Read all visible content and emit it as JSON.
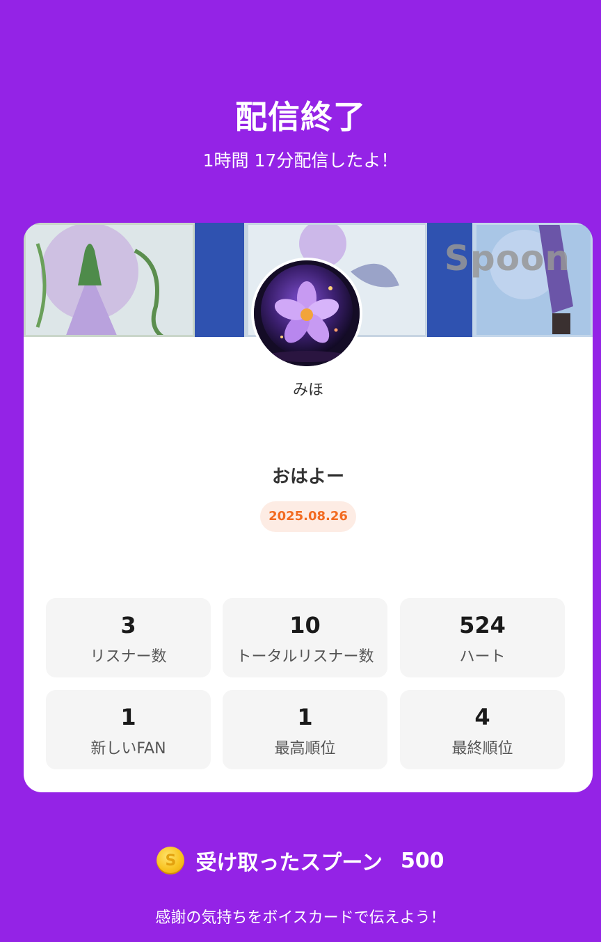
{
  "header": {
    "title": "配信終了",
    "subtitle": "1時間 17分配信したよ！"
  },
  "card": {
    "banner_watermark": "Spoon",
    "username": "みほ",
    "live_title": "おはよー",
    "date": "2025.08.26",
    "stats": [
      {
        "value": "3",
        "label": "リスナー数"
      },
      {
        "value": "10",
        "label": "トータルリスナー数"
      },
      {
        "value": "524",
        "label": "ハート"
      },
      {
        "value": "1",
        "label": "新しいFAN"
      },
      {
        "value": "1",
        "label": "最高順位"
      },
      {
        "value": "4",
        "label": "最終順位"
      }
    ]
  },
  "spoons": {
    "icon": "coin-icon",
    "icon_glyph": "S",
    "label": "受け取ったスプーン",
    "count": "500"
  },
  "footer": {
    "message": "感謝の気持ちをボイスカードで伝えよう！"
  },
  "colors": {
    "background": "#9423E6",
    "card": "#FFFFFF",
    "stat_box": "#F5F5F5",
    "date_badge_bg": "#FDECE4",
    "date_badge_text": "#F26B21"
  }
}
